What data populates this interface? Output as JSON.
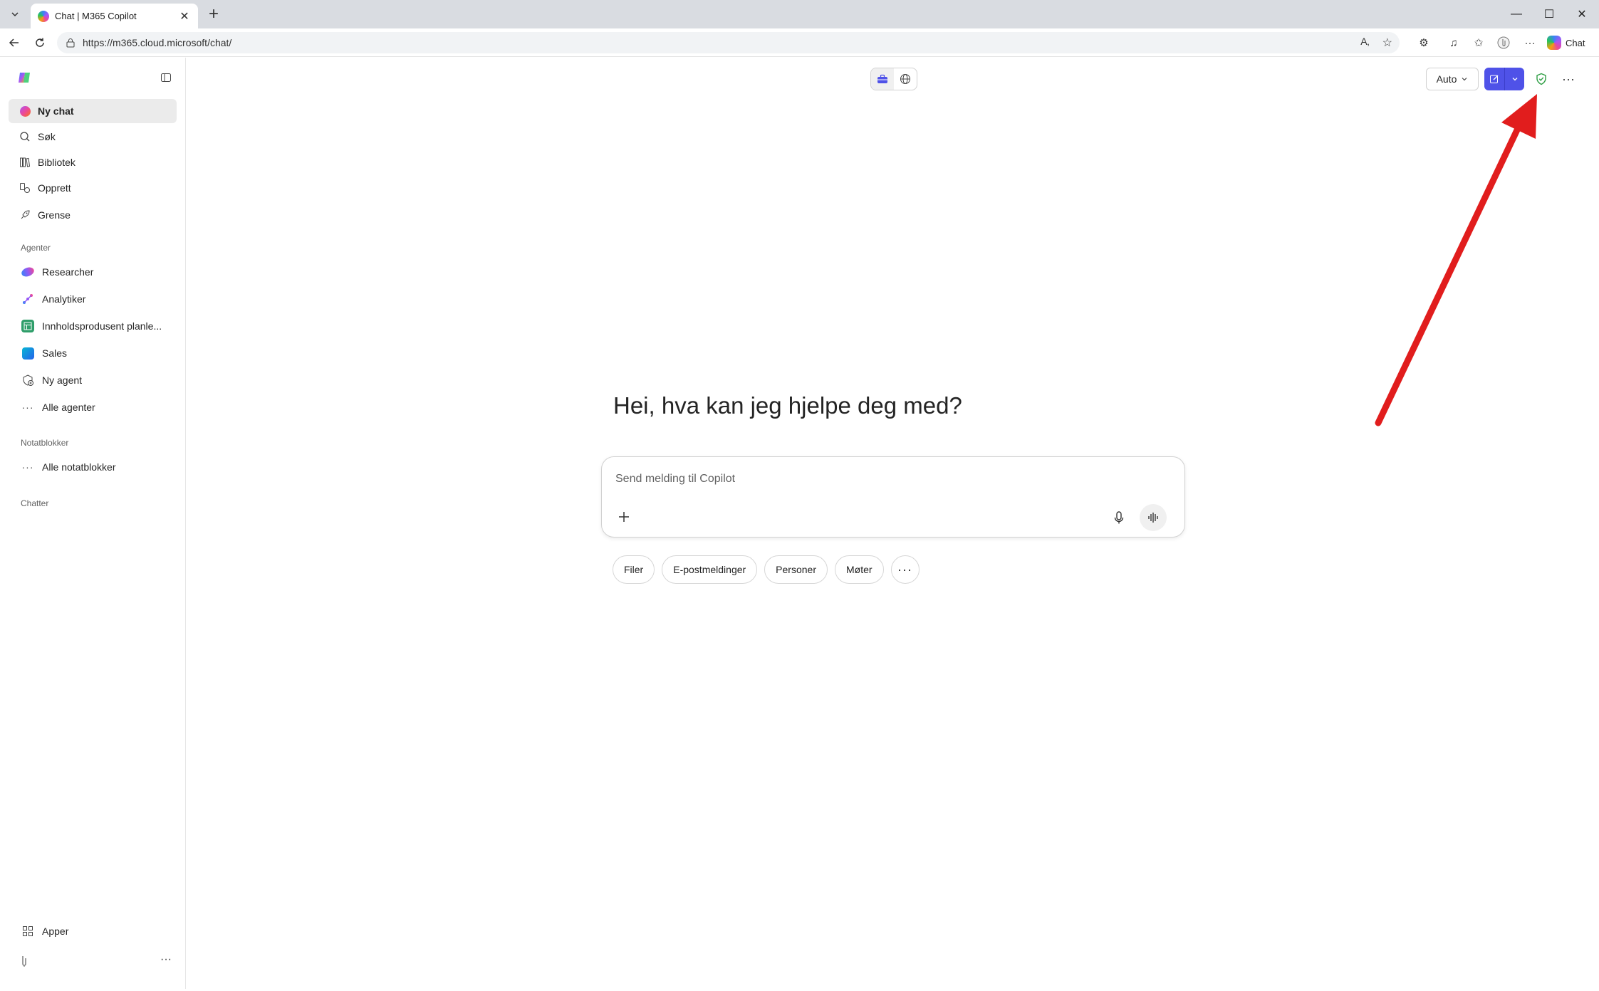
{
  "browser": {
    "tab_title": "Chat | M365 Copilot",
    "url": "https://m365.cloud.microsoft/chat/",
    "chat_button_label": "Chat"
  },
  "sidebar": {
    "nav": [
      {
        "label": "Ny chat",
        "icon": "copilot-logo-icon"
      },
      {
        "label": "Søk",
        "icon": "search-icon"
      },
      {
        "label": "Bibliotek",
        "icon": "library-icon"
      },
      {
        "label": "Opprett",
        "icon": "create-icon"
      },
      {
        "label": "Grense",
        "icon": "frontier-icon"
      }
    ],
    "agents_heading": "Agenter",
    "agents": [
      {
        "label": "Researcher",
        "icon": "researcher-icon"
      },
      {
        "label": "Analytiker",
        "icon": "analyst-icon"
      },
      {
        "label": "Innholdsprodusent planle...",
        "icon": "planner-icon"
      },
      {
        "label": "Sales",
        "icon": "sales-icon"
      },
      {
        "label": "Ny agent",
        "icon": "new-agent-icon"
      },
      {
        "label": "Alle agenter",
        "icon": "ellipsis-icon"
      }
    ],
    "notebooks_heading": "Notatblokker",
    "notebooks": [
      {
        "label": "Alle notatblokker",
        "icon": "ellipsis-icon"
      }
    ],
    "chats_heading": "Chatter",
    "apps_label": "Apper"
  },
  "header": {
    "model_select": "Auto"
  },
  "main": {
    "greeting": "Hei, hva kan jeg hjelpe deg med?",
    "composer_placeholder": "Send melding til Copilot",
    "chips": [
      "Filer",
      "E-postmeldinger",
      "Personer",
      "Møter"
    ]
  },
  "colors": {
    "accent": "#4f52e8",
    "shield": "#2e9e44",
    "annotation_arrow": "#e11d1d"
  }
}
